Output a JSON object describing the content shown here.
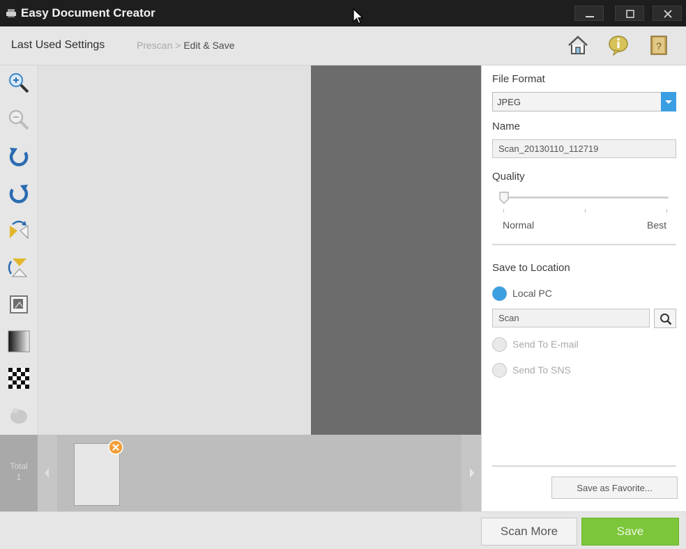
{
  "window": {
    "title": "Easy Document Creator",
    "controls": [
      "minimize-icon",
      "maximize-icon",
      "close-icon"
    ]
  },
  "header": {
    "last_used_settings": "Last Used Settings",
    "breadcrumb": {
      "step1": "Prescan",
      "separator": ">",
      "current": "Edit & Save"
    },
    "buttons": [
      "home-icon",
      "info-icon",
      "help-book-icon"
    ]
  },
  "tools": [
    "zoom-in-icon",
    "zoom-out-icon",
    "rotate-left-icon",
    "rotate-right-icon",
    "flip-horizontal-icon",
    "flip-vertical-icon",
    "crop-icon",
    "gradient-icon",
    "checkerboard-icon",
    "mask-icon"
  ],
  "thumbnails": {
    "total_label": "Total",
    "total_count": "1"
  },
  "panel": {
    "file_format_label": "File Format",
    "file_format_value": "JPEG",
    "name_label": "Name",
    "name_value": "Scan_20130110_112719",
    "quality_label": "Quality",
    "quality_min": "Normal",
    "quality_max": "Best",
    "quality_level": 0,
    "save_location_label": "Save to Location",
    "options": {
      "local_pc": "Local PC",
      "email": "Send To E-mail",
      "sns": "Send To SNS"
    },
    "selected_option": "local_pc",
    "folder_value": "Scan",
    "save_favorite": "Save as Favorite..."
  },
  "footer": {
    "scan_more": "Scan More",
    "save": "Save"
  },
  "colors": {
    "titlebar": "#1e1e1e",
    "accent_blue": "#3b9fe0",
    "save_green": "#7cc63a",
    "preview_dark": "#6c6c6c"
  }
}
